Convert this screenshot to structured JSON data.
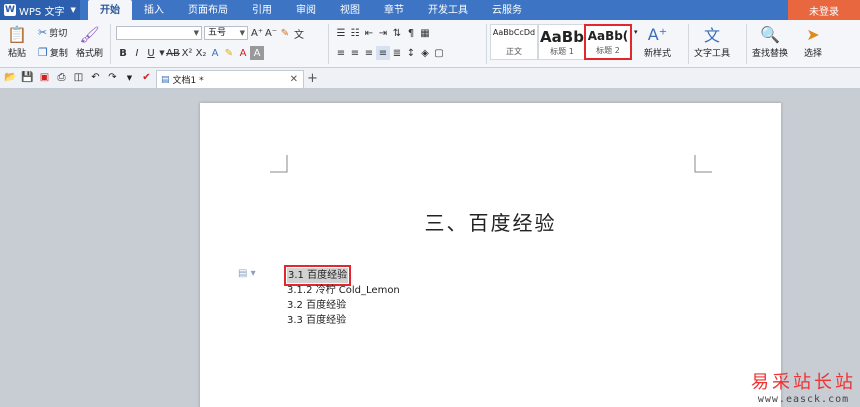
{
  "app": {
    "name": "WPS 文字"
  },
  "tabs": [
    "开始",
    "插入",
    "页面布局",
    "引用",
    "审阅",
    "视图",
    "章节",
    "开发工具",
    "云服务"
  ],
  "active_tab": "开始",
  "login": "未登录",
  "ribbon": {
    "paste": "粘贴",
    "cut": "剪切",
    "copy": "复制",
    "format_painter": "格式刷",
    "font_name": "",
    "font_size": "五号",
    "styles": [
      {
        "sample": "AaBbCcDd",
        "name": "正文"
      },
      {
        "sample": "AaBb",
        "name": "标题 1"
      },
      {
        "sample": "AaBb(",
        "name": "标题 2"
      }
    ],
    "new_style": "新样式",
    "text_tools": "文字工具",
    "find_replace": "查找替换",
    "select": "选择"
  },
  "doc_tab": {
    "title": "文档1 *"
  },
  "document": {
    "heading": "三、百度经验",
    "toc": [
      "3.1 百度经验",
      "3.1.2 冷柠 Cold_Lemon",
      "3.2 百度经验",
      "3.3 百度经验"
    ]
  },
  "watermark": {
    "cn": "易采站长站",
    "url": "www.easck.com"
  },
  "colors": {
    "title_bar": "#3d74c4",
    "login": "#e9673e",
    "highlight_border": "#e0282e"
  }
}
